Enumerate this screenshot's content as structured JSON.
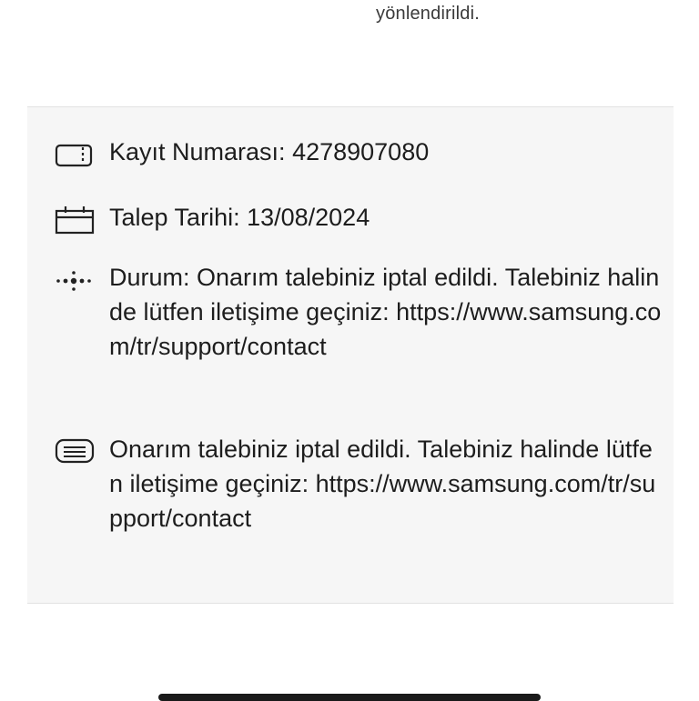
{
  "header": {
    "redirect_text": "yönlendirildi."
  },
  "details": {
    "record_number": "Kayıt Numarası: 4278907080",
    "request_date": "Talep Tarihi: 13/08/2024",
    "status": "Durum: Onarım talebiniz iptal edildi. Talebiniz halinde lütfen iletişime geçiniz: https://www.samsung.com/tr/support/contact",
    "note": "Onarım talebiniz iptal edildi. Talebiniz halinde lütfen iletişime geçiniz: https://www.samsung.com/tr/support/contact"
  },
  "icons": {
    "record_number": "ticket-icon",
    "request_date": "calendar-icon",
    "status": "progress-dots-icon",
    "note": "message-icon"
  },
  "colors": {
    "card_background": "#f6f6f6",
    "text": "#1d1d1d"
  }
}
